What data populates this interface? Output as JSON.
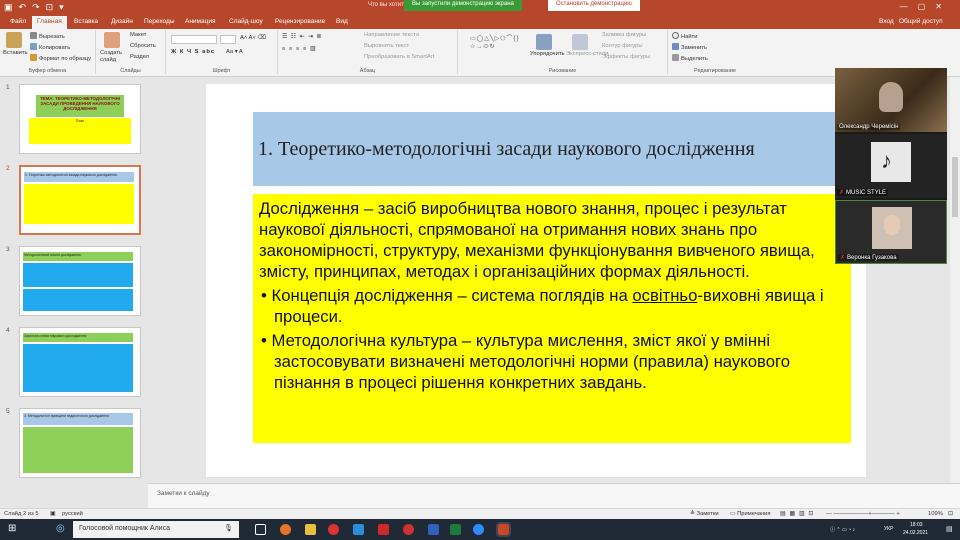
{
  "titlebar": {
    "share_note": "Что вы хотите сделать?",
    "screen_share_status": "Вы запустили демонстрацию экрана",
    "stop_share_button": "Остановить демонстрацию"
  },
  "tabs": [
    {
      "label": "Файл"
    },
    {
      "label": "Главная"
    },
    {
      "label": "Вставка"
    },
    {
      "label": "Дизайн"
    },
    {
      "label": "Переходы"
    },
    {
      "label": "Анимация"
    },
    {
      "label": "Слайд-шоу"
    },
    {
      "label": "Рецензирование"
    },
    {
      "label": "Вид"
    }
  ],
  "tabs_right": {
    "signin": "Вход",
    "share": "Общий доступ"
  },
  "ribbon": {
    "clipboard": {
      "paste": "Вставить",
      "cut": "Вырезать",
      "copy": "Копировать",
      "format_painter": "Формат по образцу",
      "group": "Буфер обмена"
    },
    "slides": {
      "new_slide": "Создать слайд",
      "layout": "Макет",
      "reset": "Сбросить",
      "section": "Раздел",
      "group": "Слайды"
    },
    "font": {
      "group": "Шрифт",
      "buttons": "Ж К Ч S abc"
    },
    "paragraph": {
      "text_direction": "Направление текста",
      "align_text": "Выровнять текст",
      "smartart": "Преобразовать в SmartArt",
      "group": "Абзац"
    },
    "drawing": {
      "arrange": "Упорядочить",
      "quick_styles": "Экспресс-стили",
      "fill": "Заливка фигуры",
      "outline": "Контур фигуры",
      "effects": "Эффекты фигуры",
      "group": "Рисование",
      "shapes_glyphs": "▭◯△╲▷⬠⌒{}☆→⬭↻"
    },
    "editing": {
      "find": "Найти",
      "replace": "Заменить",
      "select": "Выделить",
      "group": "Редактирование"
    }
  },
  "thumbnails": [
    {
      "number": "1",
      "title": "ТЕМА: ТЕОРЕТИКО-МЕТОДОЛОГІЧНІ ЗАСАДИ ПРОВЕДЕННЯ НАУКОВОГО ДОСЛІДЖЕННЯ",
      "subtitle": "План"
    },
    {
      "number": "2",
      "title": "1. Теоретико-методологічні засади наукового дослідження"
    },
    {
      "number": "3",
      "title": "Методологічний аналіз дослідження"
    },
    {
      "number": "4",
      "title": "Загальна схема наукового дослідження"
    },
    {
      "number": "5",
      "title": "3. Методологічні принципи педагогічного дослідження"
    }
  ],
  "slide": {
    "title": "1. Теоретико-методологічні засади наукового дослідження",
    "body": {
      "paragraph": "Дослідження – засіб виробництва нового знання, процес і результат наукової діяльності, спрямованої на отримання нових знань про закономірності, структуру, механізми функціонування вивченого явища, змісту, принципах, методах і організаційних формах діяльності.",
      "bullets": [
        {
          "before": "Концепція дослідження – система поглядів на ",
          "underlined": "освітньо",
          "after": "-виховні явища і процеси."
        },
        {
          "text": "Методологічна культура – культура мислення, зміст якої у вмінні застосовувати визначені методологічні норми (правила) наукового пізнання в процесі рішення конкретних завдань."
        }
      ]
    }
  },
  "notes_placeholder": "Заметки к слайду",
  "status": {
    "slide_of": "Слайд 2 из 5",
    "language": "русский",
    "notes_button": "Заметки",
    "comments_button": "Примечания",
    "zoom": "109%"
  },
  "taskbar": {
    "search_placeholder": "Голосовой помощник Алиса",
    "lang": "УКР",
    "time": "18:03",
    "date": "24.02.2021"
  },
  "video_panel": {
    "participants": [
      {
        "name": "Олександр Черемісін"
      },
      {
        "name": "MUSIC STYLE"
      },
      {
        "name": "Веронка Гузакова"
      }
    ]
  }
}
